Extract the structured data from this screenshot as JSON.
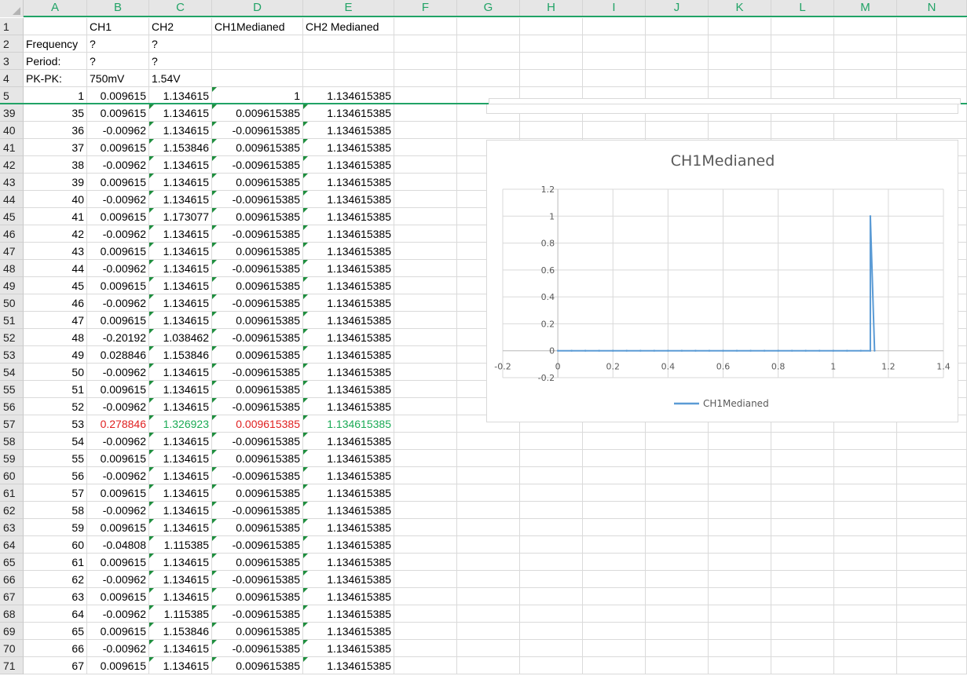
{
  "columns": [
    "A",
    "B",
    "C",
    "D",
    "E",
    "F",
    "G",
    "H",
    "I",
    "J",
    "K",
    "L",
    "M",
    "N"
  ],
  "header_rows": [
    {
      "row": "1",
      "cells": [
        "",
        "CH1",
        "CH2",
        "CH1Medianed",
        "CH2 Medianed"
      ]
    },
    {
      "row": "2",
      "cells": [
        "Frequency",
        "?",
        "?",
        "",
        ""
      ]
    },
    {
      "row": "3",
      "cells": [
        "Period:",
        "?",
        "?",
        "",
        ""
      ]
    },
    {
      "row": "4",
      "cells": [
        "PK-PK:",
        "750mV",
        "1.54V",
        "",
        ""
      ]
    },
    {
      "row": "5",
      "cells": [
        "1",
        "0.009615",
        "1.134615",
        "1",
        "1.134615385"
      ]
    }
  ],
  "data_rows": [
    {
      "row": "39",
      "a": "35",
      "b": "0.009615",
      "c": "1.134615",
      "d": "0.009615385",
      "e": "1.134615385"
    },
    {
      "row": "40",
      "a": "36",
      "b": "-0.00962",
      "c": "1.134615",
      "d": "-0.009615385",
      "e": "1.134615385"
    },
    {
      "row": "41",
      "a": "37",
      "b": "0.009615",
      "c": "1.153846",
      "d": "0.009615385",
      "e": "1.134615385"
    },
    {
      "row": "42",
      "a": "38",
      "b": "-0.00962",
      "c": "1.134615",
      "d": "-0.009615385",
      "e": "1.134615385"
    },
    {
      "row": "43",
      "a": "39",
      "b": "0.009615",
      "c": "1.134615",
      "d": "0.009615385",
      "e": "1.134615385"
    },
    {
      "row": "44",
      "a": "40",
      "b": "-0.00962",
      "c": "1.134615",
      "d": "-0.009615385",
      "e": "1.134615385"
    },
    {
      "row": "45",
      "a": "41",
      "b": "0.009615",
      "c": "1.173077",
      "d": "0.009615385",
      "e": "1.134615385"
    },
    {
      "row": "46",
      "a": "42",
      "b": "-0.00962",
      "c": "1.134615",
      "d": "-0.009615385",
      "e": "1.134615385"
    },
    {
      "row": "47",
      "a": "43",
      "b": "0.009615",
      "c": "1.134615",
      "d": "0.009615385",
      "e": "1.134615385"
    },
    {
      "row": "48",
      "a": "44",
      "b": "-0.00962",
      "c": "1.134615",
      "d": "-0.009615385",
      "e": "1.134615385"
    },
    {
      "row": "49",
      "a": "45",
      "b": "0.009615",
      "c": "1.134615",
      "d": "0.009615385",
      "e": "1.134615385"
    },
    {
      "row": "50",
      "a": "46",
      "b": "-0.00962",
      "c": "1.134615",
      "d": "-0.009615385",
      "e": "1.134615385"
    },
    {
      "row": "51",
      "a": "47",
      "b": "0.009615",
      "c": "1.134615",
      "d": "0.009615385",
      "e": "1.134615385"
    },
    {
      "row": "52",
      "a": "48",
      "b": "-0.20192",
      "c": "1.038462",
      "d": "-0.009615385",
      "e": "1.134615385"
    },
    {
      "row": "53",
      "a": "49",
      "b": "0.028846",
      "c": "1.153846",
      "d": "0.009615385",
      "e": "1.134615385"
    },
    {
      "row": "54",
      "a": "50",
      "b": "-0.00962",
      "c": "1.134615",
      "d": "-0.009615385",
      "e": "1.134615385"
    },
    {
      "row": "55",
      "a": "51",
      "b": "0.009615",
      "c": "1.134615",
      "d": "0.009615385",
      "e": "1.134615385"
    },
    {
      "row": "56",
      "a": "52",
      "b": "-0.00962",
      "c": "1.134615",
      "d": "-0.009615385",
      "e": "1.134615385"
    },
    {
      "row": "57",
      "a": "53",
      "b": "0.278846",
      "c": "1.326923",
      "d": "0.009615385",
      "e": "1.134615385",
      "highlight": true
    },
    {
      "row": "58",
      "a": "54",
      "b": "-0.00962",
      "c": "1.134615",
      "d": "-0.009615385",
      "e": "1.134615385"
    },
    {
      "row": "59",
      "a": "55",
      "b": "0.009615",
      "c": "1.134615",
      "d": "0.009615385",
      "e": "1.134615385"
    },
    {
      "row": "60",
      "a": "56",
      "b": "-0.00962",
      "c": "1.134615",
      "d": "-0.009615385",
      "e": "1.134615385"
    },
    {
      "row": "61",
      "a": "57",
      "b": "0.009615",
      "c": "1.134615",
      "d": "0.009615385",
      "e": "1.134615385"
    },
    {
      "row": "62",
      "a": "58",
      "b": "-0.00962",
      "c": "1.134615",
      "d": "-0.009615385",
      "e": "1.134615385"
    },
    {
      "row": "63",
      "a": "59",
      "b": "0.009615",
      "c": "1.134615",
      "d": "0.009615385",
      "e": "1.134615385"
    },
    {
      "row": "64",
      "a": "60",
      "b": "-0.04808",
      "c": "1.115385",
      "d": "-0.009615385",
      "e": "1.134615385"
    },
    {
      "row": "65",
      "a": "61",
      "b": "0.009615",
      "c": "1.134615",
      "d": "0.009615385",
      "e": "1.134615385"
    },
    {
      "row": "66",
      "a": "62",
      "b": "-0.00962",
      "c": "1.134615",
      "d": "-0.009615385",
      "e": "1.134615385"
    },
    {
      "row": "67",
      "a": "63",
      "b": "0.009615",
      "c": "1.134615",
      "d": "0.009615385",
      "e": "1.134615385"
    },
    {
      "row": "68",
      "a": "64",
      "b": "-0.00962",
      "c": "1.115385",
      "d": "-0.009615385",
      "e": "1.134615385"
    },
    {
      "row": "69",
      "a": "65",
      "b": "0.009615",
      "c": "1.153846",
      "d": "0.009615385",
      "e": "1.134615385"
    },
    {
      "row": "70",
      "a": "66",
      "b": "-0.00962",
      "c": "1.134615",
      "d": "-0.009615385",
      "e": "1.134615385"
    },
    {
      "row": "71",
      "a": "67",
      "b": "0.009615",
      "c": "1.134615",
      "d": "0.009615385",
      "e": "1.134615385"
    }
  ],
  "colors": {
    "accent": "#21a366",
    "error_text": "#e02020",
    "good_text": "#1aaa55",
    "series": "#5b9bd5"
  },
  "chart_data": {
    "type": "scatter",
    "title": "CH1Medianed",
    "xlabel": "",
    "ylabel": "",
    "xlim": [
      -0.2,
      1.4
    ],
    "ylim": [
      -0.2,
      1.2
    ],
    "xticks": [
      "-0.2",
      "0",
      "0.2",
      "0.4",
      "0.6",
      "0.8",
      "1",
      "1.2",
      "1.4"
    ],
    "yticks": [
      "-0.2",
      "0",
      "0.2",
      "0.4",
      "0.6",
      "0.8",
      "1",
      "1.2"
    ],
    "grid": true,
    "legend": "bottom",
    "series": [
      {
        "name": "CH1Medianed",
        "x": [
          0,
          0.05,
          0.1,
          0.15,
          0.2,
          0.25,
          0.3,
          0.35,
          0.4,
          0.45,
          0.5,
          0.55,
          0.6,
          0.65,
          0.7,
          0.75,
          0.8,
          0.85,
          0.9,
          0.95,
          1.0,
          1.05,
          1.1,
          1.134615,
          1.134615,
          1.15
        ],
        "y": [
          0,
          0,
          0,
          0,
          0,
          0,
          0,
          0,
          0,
          0,
          0,
          0,
          0,
          0,
          0,
          0,
          0,
          0,
          0,
          0,
          0,
          0,
          0,
          0,
          1,
          0
        ]
      }
    ]
  }
}
